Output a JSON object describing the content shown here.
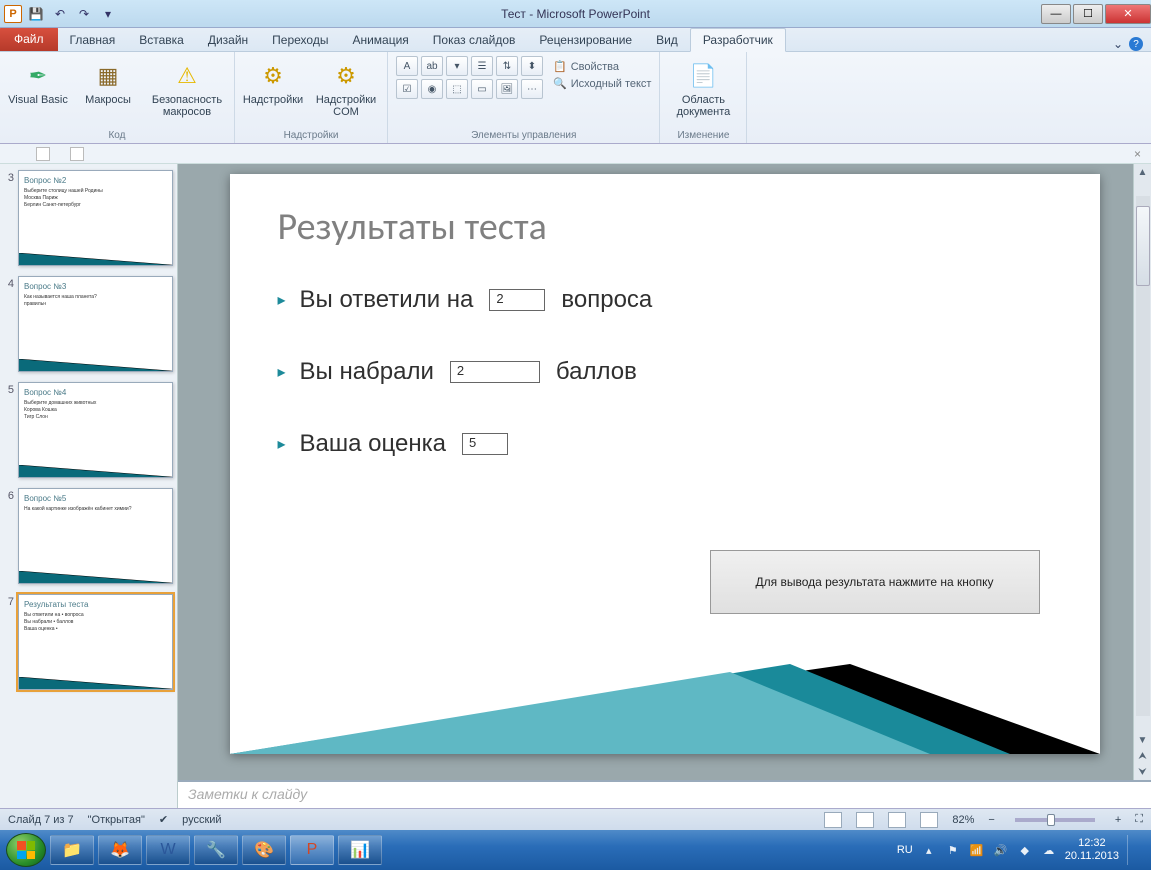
{
  "window": {
    "title": "Тест - Microsoft PowerPoint",
    "qat": {
      "save": "💾",
      "undo": "↶",
      "redo": "↷",
      "down": "▾"
    }
  },
  "ribbon": {
    "file": "Файл",
    "tabs": [
      "Главная",
      "Вставка",
      "Дизайн",
      "Переходы",
      "Анимация",
      "Показ слайдов",
      "Рецензирование",
      "Вид",
      "Разработчик"
    ],
    "active_index": 8,
    "groups": {
      "code": {
        "label": "Код",
        "vb": "Visual Basic",
        "macros": "Макросы",
        "security": "Безопасность макросов"
      },
      "addins": {
        "label": "Надстройки",
        "addins": "Надстройки",
        "com": "Надстройки COM"
      },
      "controls": {
        "label": "Элементы управления",
        "props": "Свойства",
        "source": "Исходный текст"
      },
      "change": {
        "label": "Изменение",
        "docpanel": "Область документа"
      }
    }
  },
  "thumbnails": [
    {
      "num": "3",
      "title": "Вопрос №2",
      "lines": [
        "Выберите столицу нашей Родины",
        "Москва    Париж",
        "Берлин    Санкт-петербург"
      ]
    },
    {
      "num": "4",
      "title": "Вопрос №3",
      "lines": [
        "Как называется наша планета?",
        "",
        "правильн"
      ]
    },
    {
      "num": "5",
      "title": "Вопрос №4",
      "lines": [
        "Выберите домашних животных",
        "Корова    Кошка",
        "Тигр    Слон"
      ]
    },
    {
      "num": "6",
      "title": "Вопрос №5",
      "lines": [
        "На какой картинке изображён кабинет химии?"
      ]
    },
    {
      "num": "7",
      "title": "Результаты теста",
      "lines": [
        "Вы ответили на •    вопроса",
        "Вы набрали •    баллов",
        "Ваша оценка •"
      ],
      "selected": true
    }
  ],
  "slide": {
    "title": "Результаты теста",
    "row1_a": "Вы ответили на",
    "row1_val": "2",
    "row1_b": "вопроса",
    "row2_a": "Вы набрали",
    "row2_val": "2",
    "row2_b": "баллов",
    "row3_a": "Ваша оценка",
    "row3_val": "5",
    "button": "Для вывода результата нажмите на кнопку"
  },
  "notes": {
    "placeholder": "Заметки к слайду"
  },
  "statusbar": {
    "slide": "Слайд 7 из 7",
    "theme": "\"Открытая\"",
    "lang": "русский",
    "zoom": "82%"
  },
  "taskbar": {
    "lang": "RU",
    "time": "12:32",
    "date": "20.11.2013"
  }
}
